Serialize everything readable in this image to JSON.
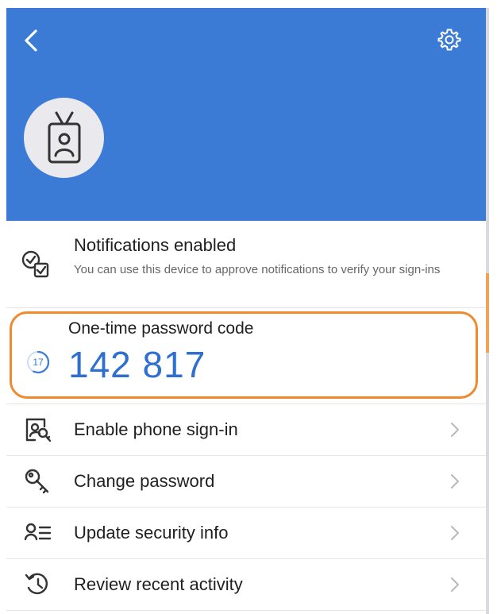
{
  "colors": {
    "header_bg": "#3b7bd6",
    "accent_blue": "#2f6fd0",
    "highlight_orange": "#f08a2e"
  },
  "header": {
    "back_icon": "chevron-left-icon",
    "settings_icon": "gear-icon",
    "avatar_icon": "id-badge-icon"
  },
  "notifications": {
    "icon": "approval-check-icon",
    "title": "Notifications enabled",
    "subtitle": "You can use this device to approve notifications to verify your sign-ins"
  },
  "otp": {
    "label": "One-time password code",
    "code": "142 817",
    "timer_seconds": "17",
    "timer_remaining_fraction": 0.57
  },
  "menu": [
    {
      "icon": "phone-signin-icon",
      "label": "Enable phone sign-in"
    },
    {
      "icon": "key-icon",
      "label": "Change password"
    },
    {
      "icon": "security-info-icon",
      "label": "Update security info"
    },
    {
      "icon": "history-icon",
      "label": "Review recent activity"
    }
  ]
}
